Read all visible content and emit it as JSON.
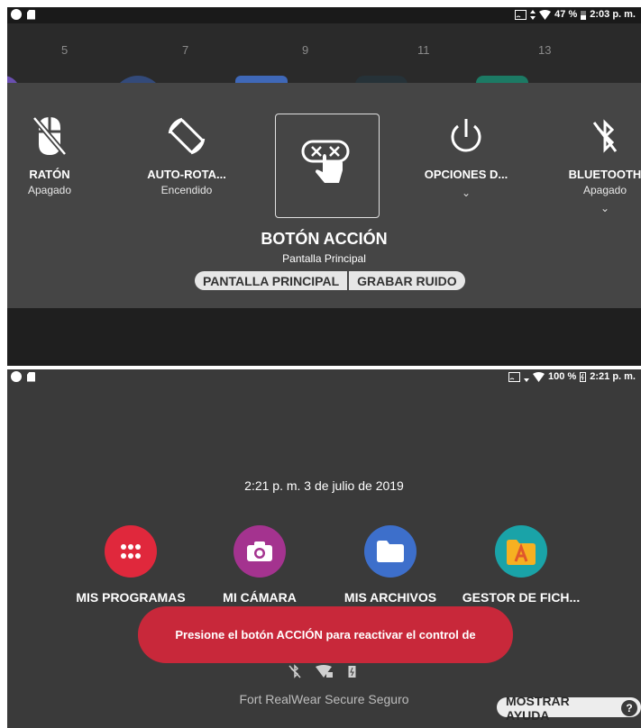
{
  "top": {
    "status": {
      "battery": "47 %",
      "time": "2:03 p. m."
    },
    "launcher_numbers": [
      "5",
      "7",
      "9",
      "11",
      "13"
    ],
    "tiles": [
      {
        "label": "RATÓN",
        "sub": "Apagado",
        "icon": "mouse-off-icon"
      },
      {
        "label": "AUTO-ROTA...",
        "sub": "Encendido",
        "icon": "screen-rotation-icon"
      },
      {
        "label": "OPCIONES D...",
        "sub": "",
        "icon": "power-icon",
        "chevron": "⌄"
      },
      {
        "label": "BLUETOOTH",
        "sub": "Apagado",
        "icon": "bluetooth-off-icon",
        "chevron": "⌄"
      }
    ],
    "action": {
      "title": "BOTÓN ACCIÓN",
      "subtitle": "Pantalla Principal",
      "options": [
        "PANTALLA PRINCIPAL",
        "GRABAR RUIDO"
      ],
      "icon": "action-button-press-icon"
    }
  },
  "bottom": {
    "status": {
      "battery": "100 %",
      "time": "2:21 p. m."
    },
    "datetime": "2:21 p. m. 3 de julio de 2019",
    "apps": [
      {
        "label": "MIS PROGRAMAS",
        "color": "#e0283c",
        "icon": "apps-grid-icon"
      },
      {
        "label": "MI CÁMARA",
        "color": "#a4338f",
        "icon": "camera-icon"
      },
      {
        "label": "MIS ARCHIVOS",
        "color": "#3d6fcb",
        "icon": "folder-icon"
      },
      {
        "label": "GESTOR DE FICH...",
        "color": "#1aa3a8",
        "icon": "file-manager-icon"
      }
    ],
    "toast": "Presione el botón ACCIÓN para reactivar el control de",
    "footer": "Fort RealWear Secure Seguro",
    "help_button": "MOSTRAR AYUDA",
    "help_glyph": "?"
  }
}
